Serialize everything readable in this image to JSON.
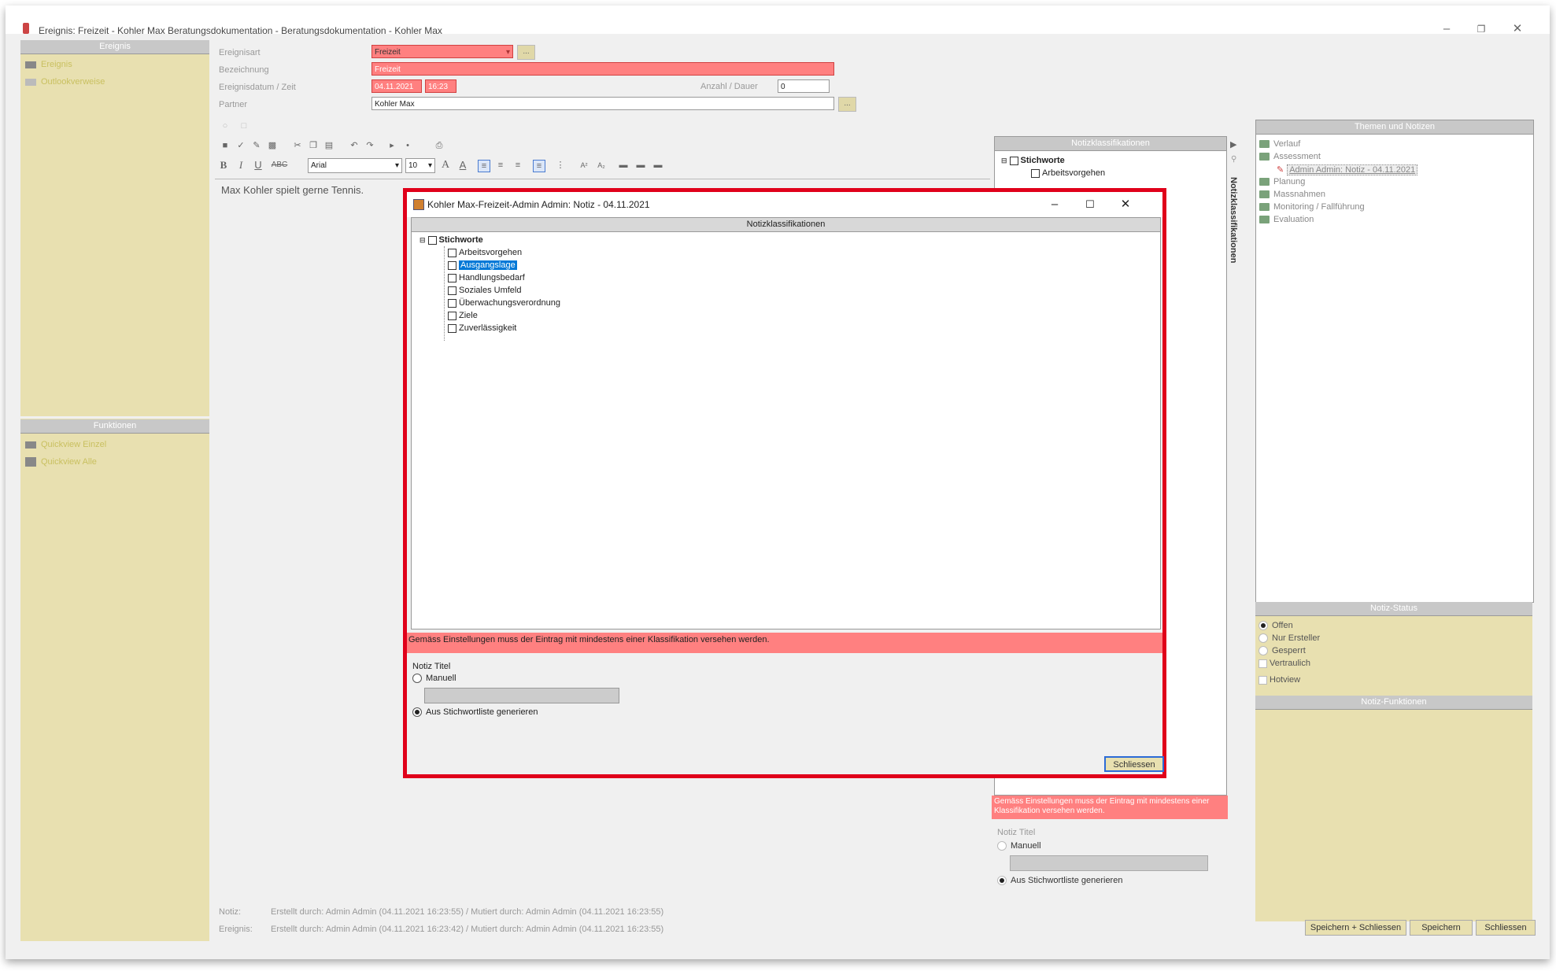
{
  "window": {
    "title": "Ereignis: Freizeit - Kohler Max Beratungsdokumentation - Beratungsdokumentation - Kohler Max"
  },
  "left_panel": {
    "header": "Ereignis",
    "items": [
      {
        "label": "Ereignis"
      },
      {
        "label": "Outlookverweise"
      }
    ],
    "functions_header": "Funktionen",
    "functions": [
      {
        "label": "Quickview Einzel"
      },
      {
        "label": "Quickview Alle"
      }
    ]
  },
  "form": {
    "ereignisart_label": "Ereignisart",
    "ereignisart_value": "Freizeit",
    "bezeichnung_label": "Bezeichnung",
    "bezeichnung_value": "Freizeit",
    "datum_label": "Ereignisdatum / Zeit",
    "datum_value": "04.11.2021",
    "zeit_value": "16:23",
    "anzahl_label": "Anzahl / Dauer",
    "anzahl_value": "0",
    "partner_label": "Partner",
    "partner_value": "Kohler Max",
    "dots": "..."
  },
  "editor": {
    "font": "Arial",
    "size": "10",
    "content": "Max Kohler spielt gerne Tennis."
  },
  "notiz_panel": {
    "header": "Notizklassifikationen",
    "root": "Stichworte",
    "first_item": "Arbeitsvorgehen",
    "vertical_tab": "Notizklassifikationen",
    "warning": "Gemäss Einstellungen muss der Eintrag mit mindestens einer Klassifikation versehen werden.",
    "title_label": "Notiz Titel",
    "manual_label": "Manuell",
    "generate_label": "Aus Stichwortliste generieren"
  },
  "dialog": {
    "title": "Kohler Max-Freizeit-Admin Admin: Notiz - 04.11.2021",
    "header": "Notizklassifikationen",
    "root": "Stichworte",
    "items": [
      {
        "label": "Arbeitsvorgehen"
      },
      {
        "label": "Ausgangslage"
      },
      {
        "label": "Handlungsbedarf"
      },
      {
        "label": "Soziales Umfeld"
      },
      {
        "label": "Überwachungsverordnung"
      },
      {
        "label": "Ziele"
      },
      {
        "label": "Zuverlässigkeit"
      }
    ],
    "warning": "Gemäss Einstellungen muss der Eintrag mit mindestens einer Klassifikation versehen werden.",
    "title_label": "Notiz Titel",
    "manual_label": "Manuell",
    "generate_label": "Aus Stichwortliste generieren",
    "close_button": "Schliessen"
  },
  "themen": {
    "header": "Themen und Notizen",
    "items": [
      {
        "label": "Verlauf"
      },
      {
        "label": "Assessment"
      },
      {
        "label": "Admin Admin: Notiz - 04.11.2021"
      },
      {
        "label": "Planung"
      },
      {
        "label": "Massnahmen"
      },
      {
        "label": "Monitoring / Fallführung"
      },
      {
        "label": "Evaluation"
      }
    ]
  },
  "status": {
    "header": "Notiz-Status",
    "options": [
      {
        "label": "Offen"
      },
      {
        "label": "Nur Ersteller"
      },
      {
        "label": "Gesperrt"
      }
    ],
    "checks": [
      {
        "label": "Vertraulich"
      },
      {
        "label": "Hotview"
      }
    ],
    "functions_header": "Notiz-Funktionen"
  },
  "footer": {
    "notiz_label": "Notiz:",
    "notiz_text": "Erstellt durch: Admin Admin (04.11.2021 16:23:55) / Mutiert durch: Admin Admin (04.11.2021 16:23:55)",
    "ereignis_label": "Ereignis:",
    "ereignis_text": "Erstellt durch: Admin Admin (04.11.2021 16:23:42) / Mutiert durch: Admin Admin (04.11.2021 16:23:55)",
    "buttons": [
      {
        "label": "Speichern + Schliessen"
      },
      {
        "label": "Speichern"
      },
      {
        "label": "Schliessen"
      }
    ]
  },
  "colors": {
    "accent_red": "#e0001a",
    "required_field": "#ff8080",
    "panel_bg": "#e8e0b0",
    "selection": "#0078d7"
  }
}
